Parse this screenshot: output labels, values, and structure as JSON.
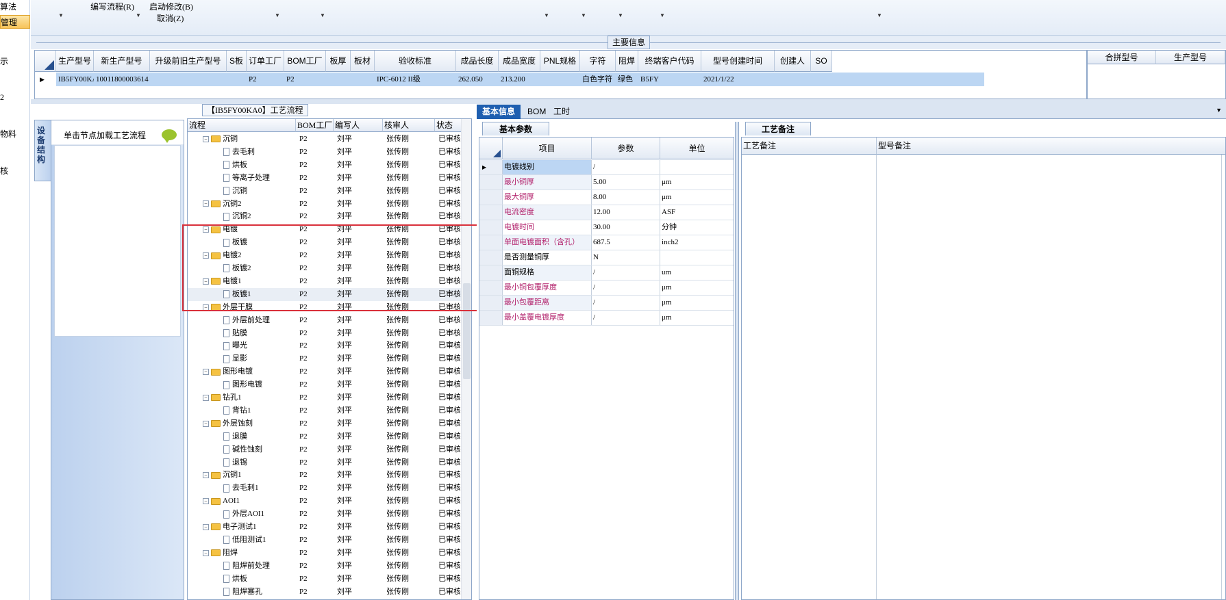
{
  "left_nav": {
    "items": [
      "算法",
      "管理",
      "示",
      "2",
      "物料",
      "核"
    ]
  },
  "toolbar": {
    "edit_flow": "编写流程(R)",
    "start_modify": "启动修改(B)",
    "cancel": "取消(Z)"
  },
  "main_info": {
    "title": "主要信息",
    "columns": [
      "生产型号",
      "新生产型号",
      "升级前旧生产型号",
      "S板",
      "订单工厂",
      "BOM工厂",
      "板厚",
      "板材",
      "验收标准",
      "成品长度",
      "成品宽度",
      "PNL规格",
      "字符",
      "阻焊",
      "终端客户代码",
      "型号创建时间",
      "创建人",
      "SO"
    ],
    "row": [
      "IB5FY00KA0",
      "10011800003614",
      "",
      "",
      "P2",
      "P2",
      "",
      "",
      "IPC-6012 II级",
      "262.050",
      "213.200",
      "",
      "白色字符",
      "绿色",
      "B5FY",
      "2021/1/22",
      "",
      ""
    ],
    "right_columns": [
      "合拼型号",
      "生产型号"
    ]
  },
  "left_panel": {
    "tab": "设备结构",
    "load_hint": "单击节点加载工艺流程"
  },
  "flow": {
    "caption": "【IB5FY00KA0】工艺流程",
    "columns": [
      "流程",
      "BOM工厂",
      "编写人",
      "核审人",
      "状态"
    ],
    "rows": [
      {
        "level": 0,
        "name": "沉铜",
        "bom": "P2",
        "writer": "刘平",
        "checker": "张传刚",
        "status": "已审核"
      },
      {
        "level": 1,
        "name": "去毛刺",
        "bom": "P2",
        "writer": "刘平",
        "checker": "张传刚",
        "status": "已审核"
      },
      {
        "level": 1,
        "name": "烘板",
        "bom": "P2",
        "writer": "刘平",
        "checker": "张传刚",
        "status": "已审核"
      },
      {
        "level": 1,
        "name": "等离子处理",
        "bom": "P2",
        "writer": "刘平",
        "checker": "张传刚",
        "status": "已审核"
      },
      {
        "level": 1,
        "name": "沉铜",
        "bom": "P2",
        "writer": "刘平",
        "checker": "张传刚",
        "status": "已审核"
      },
      {
        "level": 0,
        "name": "沉铜2",
        "bom": "P2",
        "writer": "刘平",
        "checker": "张传刚",
        "status": "已审核"
      },
      {
        "level": 1,
        "name": "沉铜2",
        "bom": "P2",
        "writer": "刘平",
        "checker": "张传刚",
        "status": "已审核"
      },
      {
        "level": 0,
        "name": "电镀",
        "bom": "P2",
        "writer": "刘平",
        "checker": "张传刚",
        "status": "已审核"
      },
      {
        "level": 1,
        "name": "板镀",
        "bom": "P2",
        "writer": "刘平",
        "checker": "张传刚",
        "status": "已审核"
      },
      {
        "level": 0,
        "name": "电镀2",
        "bom": "P2",
        "writer": "刘平",
        "checker": "张传刚",
        "status": "已审核"
      },
      {
        "level": 1,
        "name": "板镀2",
        "bom": "P2",
        "writer": "刘平",
        "checker": "张传刚",
        "status": "已审核"
      },
      {
        "level": 0,
        "name": "电镀1",
        "bom": "P2",
        "writer": "刘平",
        "checker": "张传刚",
        "status": "已审核"
      },
      {
        "level": 1,
        "name": "板镀1",
        "bom": "P2",
        "writer": "刘平",
        "checker": "张传刚",
        "status": "已审核",
        "selected": true
      },
      {
        "level": 0,
        "name": "外层干膜",
        "bom": "P2",
        "writer": "刘平",
        "checker": "张传刚",
        "status": "已审核"
      },
      {
        "level": 1,
        "name": "外层前处理",
        "bom": "P2",
        "writer": "刘平",
        "checker": "张传刚",
        "status": "已审核"
      },
      {
        "level": 1,
        "name": "贴膜",
        "bom": "P2",
        "writer": "刘平",
        "checker": "张传刚",
        "status": "已审核"
      },
      {
        "level": 1,
        "name": "曝光",
        "bom": "P2",
        "writer": "刘平",
        "checker": "张传刚",
        "status": "已审核"
      },
      {
        "level": 1,
        "name": "显影",
        "bom": "P2",
        "writer": "刘平",
        "checker": "张传刚",
        "status": "已审核"
      },
      {
        "level": 0,
        "name": "图形电镀",
        "bom": "P2",
        "writer": "刘平",
        "checker": "张传刚",
        "status": "已审核"
      },
      {
        "level": 1,
        "name": "图形电镀",
        "bom": "P2",
        "writer": "刘平",
        "checker": "张传刚",
        "status": "已审核"
      },
      {
        "level": 0,
        "name": "钻孔1",
        "bom": "P2",
        "writer": "刘平",
        "checker": "张传刚",
        "status": "已审核"
      },
      {
        "level": 1,
        "name": "背钻1",
        "bom": "P2",
        "writer": "刘平",
        "checker": "张传刚",
        "status": "已审核"
      },
      {
        "level": 0,
        "name": "外层蚀刻",
        "bom": "P2",
        "writer": "刘平",
        "checker": "张传刚",
        "status": "已审核"
      },
      {
        "level": 1,
        "name": "退膜",
        "bom": "P2",
        "writer": "刘平",
        "checker": "张传刚",
        "status": "已审核"
      },
      {
        "level": 1,
        "name": "碱性蚀刻",
        "bom": "P2",
        "writer": "刘平",
        "checker": "张传刚",
        "status": "已审核"
      },
      {
        "level": 1,
        "name": "退锡",
        "bom": "P2",
        "writer": "刘平",
        "checker": "张传刚",
        "status": "已审核"
      },
      {
        "level": 0,
        "name": "沉铜1",
        "bom": "P2",
        "writer": "刘平",
        "checker": "张传刚",
        "status": "已审核"
      },
      {
        "level": 1,
        "name": "去毛刺1",
        "bom": "P2",
        "writer": "刘平",
        "checker": "张传刚",
        "status": "已审核"
      },
      {
        "level": 0,
        "name": "AOI1",
        "bom": "P2",
        "writer": "刘平",
        "checker": "张传刚",
        "status": "已审核"
      },
      {
        "level": 1,
        "name": "外层AOI1",
        "bom": "P2",
        "writer": "刘平",
        "checker": "张传刚",
        "status": "已审核"
      },
      {
        "level": 0,
        "name": "电子测试1",
        "bom": "P2",
        "writer": "刘平",
        "checker": "张传刚",
        "status": "已审核"
      },
      {
        "level": 1,
        "name": "低阻测试1",
        "bom": "P2",
        "writer": "刘平",
        "checker": "张传刚",
        "status": "已审核"
      },
      {
        "level": 0,
        "name": "阻焊",
        "bom": "P2",
        "writer": "刘平",
        "checker": "张传刚",
        "status": "已审核"
      },
      {
        "level": 1,
        "name": "阻焊前处理",
        "bom": "P2",
        "writer": "刘平",
        "checker": "张传刚",
        "status": "已审核"
      },
      {
        "level": 1,
        "name": "烘板",
        "bom": "P2",
        "writer": "刘平",
        "checker": "张传刚",
        "status": "已审核"
      },
      {
        "level": 1,
        "name": "阻焊塞孔",
        "bom": "P2",
        "writer": "刘平",
        "checker": "张传刚",
        "status": "已审核"
      }
    ]
  },
  "right_tabs": [
    "基本信息",
    "BOM",
    "工时"
  ],
  "basic": {
    "tab": "基本参数",
    "columns": [
      "项目",
      "参数",
      "单位"
    ],
    "rows": [
      {
        "item": "电镀线别",
        "value": "/",
        "unit": "",
        "pink": false
      },
      {
        "item": "最小铜厚",
        "value": "5.00",
        "unit": "μm",
        "pink": true
      },
      {
        "item": "最大铜厚",
        "value": "8.00",
        "unit": "μm",
        "pink": true
      },
      {
        "item": "电流密度",
        "value": "12.00",
        "unit": "ASF",
        "pink": true
      },
      {
        "item": "电镀时间",
        "value": "30.00",
        "unit": "分钟",
        "pink": true
      },
      {
        "item": "单面电镀面积（含孔）",
        "value": "687.5",
        "unit": "inch2",
        "pink": true
      },
      {
        "item": "是否测量铜厚",
        "value": "N",
        "unit": "",
        "pink": false
      },
      {
        "item": "面铜规格",
        "value": "/",
        "unit": "um",
        "pink": false
      },
      {
        "item": "最小铜包覆厚度",
        "value": "/",
        "unit": "μm",
        "pink": true
      },
      {
        "item": "最小包覆距离",
        "value": "/",
        "unit": "μm",
        "pink": true
      },
      {
        "item": "最小盖覆电镀厚度",
        "value": "/",
        "unit": "μm",
        "pink": true
      }
    ]
  },
  "notes": {
    "tab": "工艺备注",
    "columns": [
      "工艺备注",
      "型号备注"
    ]
  },
  "colors": {
    "accent": "#1f5fb0",
    "selection": "#bcd6f3",
    "highlight": "#d9303a",
    "pink_text": "#b3246d"
  }
}
